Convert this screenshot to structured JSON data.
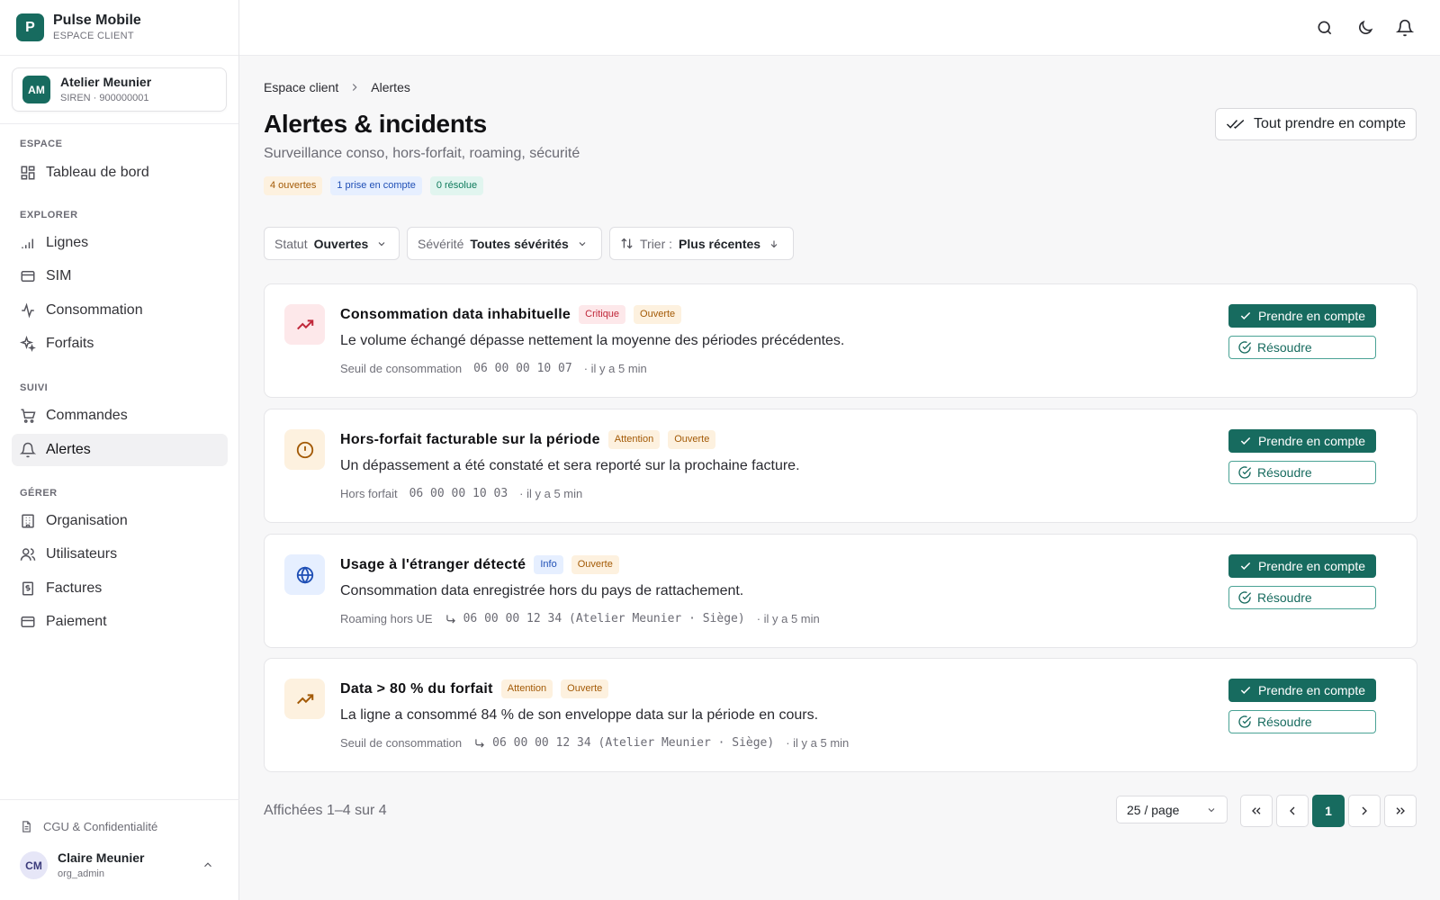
{
  "app": {
    "logo_letter": "P",
    "name": "Pulse Mobile",
    "subtitle": "ESPACE CLIENT"
  },
  "org": {
    "initials": "AM",
    "name": "Atelier Meunier",
    "siren": "SIREN · 900000001"
  },
  "nav": {
    "sections": [
      {
        "label": "ESPACE",
        "items": [
          {
            "label": "Tableau de bord",
            "icon": "dashboard-icon"
          }
        ]
      },
      {
        "label": "EXPLORER",
        "items": [
          {
            "label": "Lignes",
            "icon": "signal-bars-icon"
          },
          {
            "label": "SIM",
            "icon": "sim-card-icon"
          },
          {
            "label": "Consommation",
            "icon": "activity-icon"
          },
          {
            "label": "Forfaits",
            "icon": "sparkles-icon"
          }
        ]
      },
      {
        "label": "SUIVI",
        "items": [
          {
            "label": "Commandes",
            "icon": "cart-icon"
          },
          {
            "label": "Alertes",
            "icon": "bell-icon",
            "active": true
          }
        ]
      },
      {
        "label": "GÉRER",
        "items": [
          {
            "label": "Organisation",
            "icon": "building-icon"
          },
          {
            "label": "Utilisateurs",
            "icon": "users-icon"
          },
          {
            "label": "Factures",
            "icon": "invoice-icon"
          },
          {
            "label": "Paiement",
            "icon": "credit-card-icon"
          }
        ]
      }
    ]
  },
  "footer": {
    "cgu": "CGU & Confidentialité",
    "user_initials": "CM",
    "user_name": "Claire Meunier",
    "user_role": "org_admin"
  },
  "breadcrumb": {
    "root": "Espace client",
    "current": "Alertes"
  },
  "page": {
    "title": "Alertes & incidents",
    "subtitle": "Surveillance conso, hors-forfait, roaming, sécurité",
    "ack_all": "Tout prendre en compte",
    "badges": {
      "open": "4 ouvertes",
      "acknowledged": "1 prise en compte",
      "resolved": "0 résolue"
    }
  },
  "filters": {
    "status_label": "Statut",
    "status_value": "Ouvertes",
    "severity_label": "Sévérité",
    "severity_value": "Toutes sévérités",
    "sort_label": "Trier :",
    "sort_value": "Plus récentes"
  },
  "alerts": [
    {
      "title": "Consommation data inhabituelle",
      "severity": "Critique",
      "status": "Ouverte",
      "description": "Le volume échangé dépasse nettement la moyenne des périodes précédentes.",
      "type": "Seuil de consommation",
      "number": "06 00 00 10 07",
      "ago": "· il y a 5 min",
      "icon": "trending-up-icon"
    },
    {
      "title": "Hors-forfait facturable sur la période",
      "severity": "Attention",
      "status": "Ouverte",
      "description": "Un dépassement a été constaté et sera reporté sur la prochaine facture.",
      "type": "Hors forfait",
      "number": "06 00 00 10 03",
      "ago": "· il y a 5 min",
      "icon": "alert-circle-icon"
    },
    {
      "title": "Usage à l'étranger détecté",
      "severity": "Info",
      "status": "Ouverte",
      "description": "Consommation data enregistrée hors du pays de rattachement.",
      "type": "Roaming hors UE",
      "number": "06 00 00 12 34 (Atelier Meunier · Siège)",
      "ago": "· il y a 5 min",
      "icon": "globe-icon"
    },
    {
      "title": "Data > 80 % du forfait",
      "severity": "Attention",
      "status": "Ouverte",
      "description": "La ligne a consommé 84 % de son enveloppe data sur la période en cours.",
      "type": "Seuil de consommation",
      "number": "06 00 00 12 34 (Atelier Meunier · Siège)",
      "ago": "· il y a 5 min",
      "icon": "trending-up-icon"
    }
  ],
  "actions": {
    "ack": "Prendre en compte",
    "resolve": "Résoudre"
  },
  "pagination": {
    "shown": "Affichées 1–4 sur 4",
    "per_page": "25 / page",
    "current": "1"
  },
  "colors": {
    "accent": "#176b5f",
    "critical_bg": "#fde8ea",
    "critical_fg": "#c0283a",
    "warn_bg": "#fdf1df",
    "warn_fg": "#a35a06",
    "info_bg": "#e6efff",
    "info_fg": "#1f4fb5",
    "ok_bg": "#e1f5ef",
    "ok_fg": "#0d7a5b"
  }
}
